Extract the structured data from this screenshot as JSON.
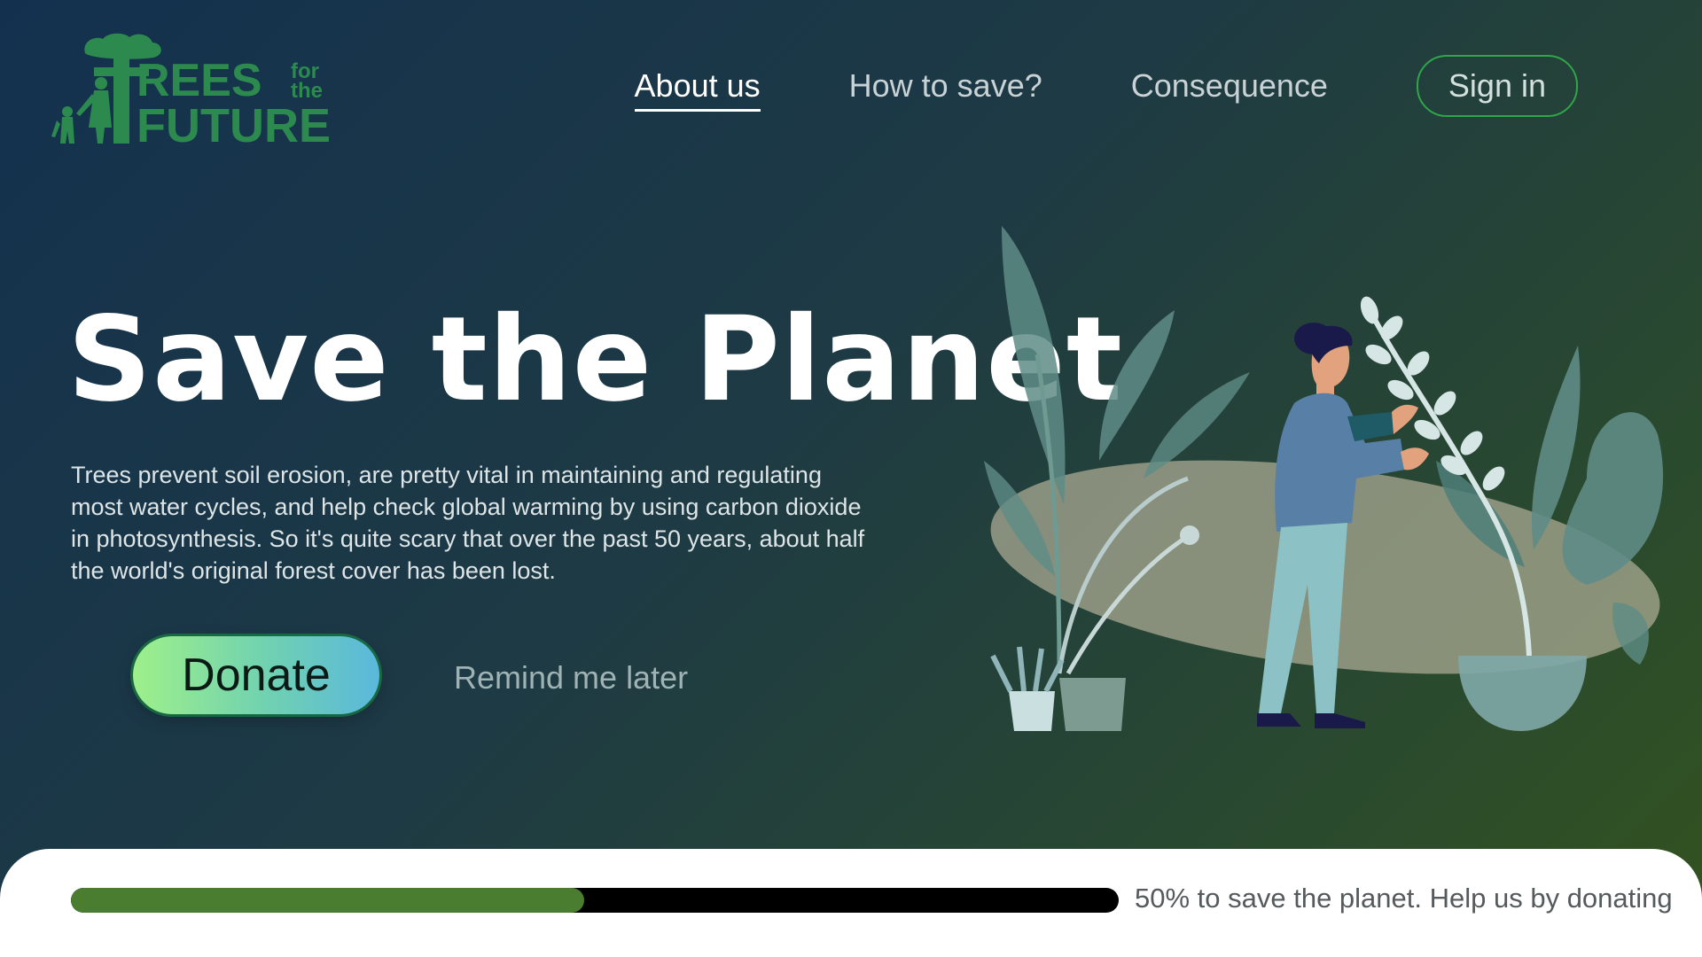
{
  "logo": {
    "word_trees": "REES",
    "word_small_1": "for",
    "word_small_2": "the",
    "word_future": "FUTURE",
    "color": "#2c8a4f"
  },
  "nav": {
    "items": [
      {
        "label": "About us",
        "active": true
      },
      {
        "label": "How to save?",
        "active": false
      },
      {
        "label": "Consequence",
        "active": false
      }
    ],
    "signin_label": "Sign in"
  },
  "hero": {
    "title": "Save the Planet",
    "description": "Trees prevent soil erosion, are pretty vital in maintaining and regulating most water cycles, and help check global warming by using carbon dioxide in photosynthesis. So it's quite scary that over the past 50 years, about half the world's original forest cover has been lost.",
    "donate_label": "Donate",
    "remind_label": "Remind me later"
  },
  "progress": {
    "percent": 49,
    "text": "50% to save the planet. Help us by donating",
    "fill_color": "#4a7d2f",
    "track_color": "#000000"
  },
  "colors": {
    "accent_green": "#2fa648",
    "bg_start": "#13314f",
    "bg_end": "#33531f"
  }
}
